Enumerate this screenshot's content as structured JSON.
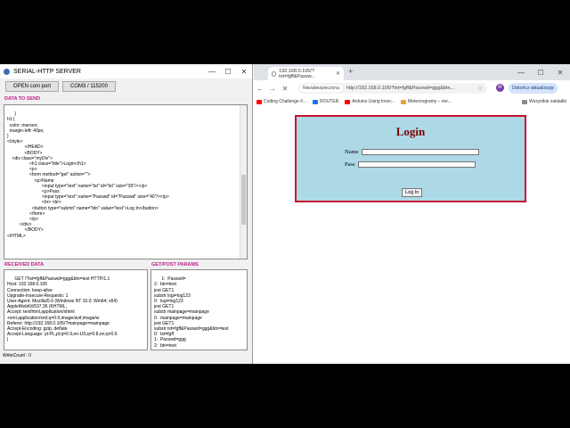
{
  "serial": {
    "title": "SERIAL-HTTP SERVER",
    "open_port_label": "OPEN com port",
    "com_label": "COM3 / 115200",
    "data_to_send_label": "DATA TO SEND",
    "data_to_send": "}\nh1 {\n  color: maroon;\n  margin-left: 40px;\n}\n</style>\n              </HEAD>\n              <BODY>\n    <div class=\"myDiv\">\n                  <h1 class=\"title\">Login</h1>\n                  <p>\n                  <form method=\"get\" action=\"\">\n                      <p>Name\n                            <input type=\"text\" name=\"txt\" id=\"txt\" size=\"39\"/></p>\n                            <p>Pass\n                            <input type=\"text\" name=\"Passwd\" id=\"Passwd\" size=\"40\"/></p>\n                            <br> <br>\n                    <button type=\"submit\" name=\"btn\" value=\"test\">Log In</button>\n                  </form>\n                  </p>\n          </div>\n              </BODY>\n</HTML>",
    "received_label": "RECEIVED DATA",
    "received_data": "GET /?txt=fgff&Passwd=ggg&btn=test HTTP/1.1\nHost: 192.168.0.105\nConnection: keep-alive\nUpgrade-Insecure-Requests: 1\nUser-Agent: Mozilla/5.0 (Windows NT 10.0; Win64; x64)\nAppleWebKit/537.36 (KHTML,\nAccept: text/html,application/xhtml\n+xml,application/xml;q=0.9,image/avif,image/w\nReferer: http://192.168.0.105/?mainpage=mainpage\nAccept-Encoding: gzip, deflate\nAccept-Language: pl-PL,pl;q=0.9,en-US;q=0.8,en;q=0.6\n|",
    "params_label": "GET/POST PARAMS",
    "params_data": "1:  Passwd=\n2:  btn=test\njest GET1\nsubstr logi=log123\n0:  logi=log123\njest GET1\nsubstr mainpage=mainpage\n0:  mainpage=mainpage\njest GET1\nsubstr txt=fgff&Passwd=ggg&btn=test\n0:  txt=fgff\n1:  Passwd=ggg\n2:  btn=test",
    "write_count": "WriteCount : 0"
  },
  "browser": {
    "tab_title": "192.168.0.105/?txt=fgff&Passw...",
    "not_secure": "Niezabezpieczona",
    "url": "http://192.168.0.105/?txt=fgff&Passwd=ggg&btn...",
    "profile_initial": "M",
    "update_label": "Dokończ aktualizację",
    "bookmarks": [
      {
        "label": "Coding Challenge #...",
        "color": "#ff0000"
      },
      {
        "label": "ROUTER",
        "color": "#1a73e8"
      },
      {
        "label": "Arduino Using Inver...",
        "color": "#ff0000"
      },
      {
        "label": "Meteorogramy – me...",
        "color": "#e8a33a"
      }
    ],
    "other_bookmarks": "Wszystkie zakładki"
  },
  "login": {
    "title": "Login",
    "name_label": "Name",
    "pass_label": "Pass",
    "button_label": "Log In"
  }
}
